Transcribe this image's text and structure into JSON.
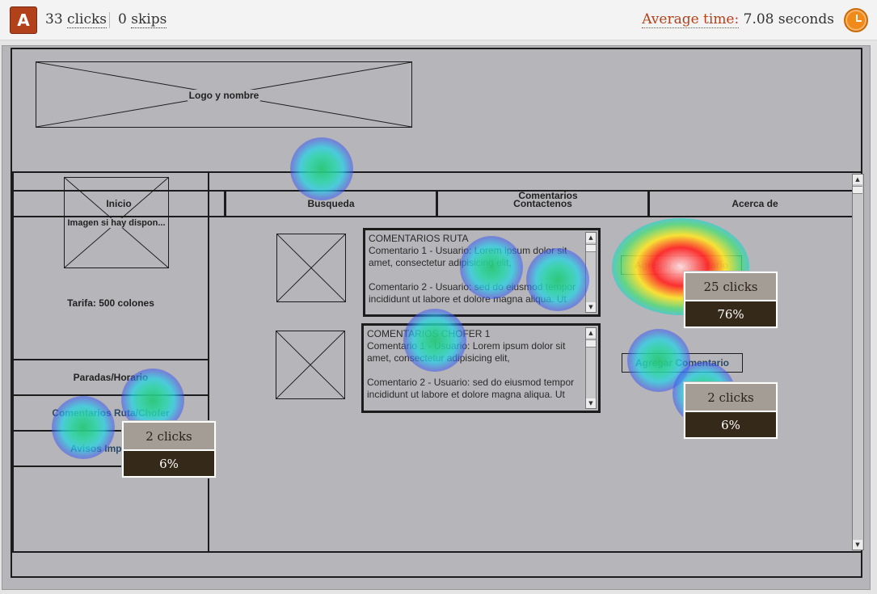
{
  "header": {
    "badge": "A",
    "clicks_count": "33",
    "clicks_label": "clicks",
    "skips_count": "0",
    "skips_label": "skips",
    "avg_label": "Average time:",
    "avg_value": "7.08 seconds"
  },
  "wireframe": {
    "logo": "Logo y nombre",
    "nav": [
      "Inicio",
      "Busqueda",
      "Contactenos",
      "Acerca de"
    ],
    "image_placeholder": "Imagen si hay dispon...",
    "tarifa": "Tarifa:  500 colones",
    "side_menu": [
      "Paradas/Horario",
      "Comentarios Ruta/Chofer",
      "Avisos Impo"
    ],
    "section_title": "Comentarios",
    "comments_ruta": {
      "title": "COMENTARIOS RUTA",
      "lines": [
        "Comentario 1 - Usuario: Lorem ipsum dolor sit",
        "amet, consectetur adipisicing elit,",
        "",
        "Comentario 2 - Usuario: sed do eiusmod tempor",
        "incididunt ut labore et dolore magna aliqua. Ut"
      ]
    },
    "comments_chofer": {
      "title": "COMENTARIOS CHOFER 1",
      "lines": [
        "Comentario 1 - Usuario: Lorem ipsum dolor sit",
        "amet, consectetur adipisicing elit,",
        "",
        "Comentario 2 - Usuario: sed do eiusmod tempor",
        "incididunt ut labore et dolore magna aliqua. Ut"
      ]
    },
    "add_comment_1": "Agregar Comentario",
    "add_comment_2": "Agregar Comentario"
  },
  "tooltips": [
    {
      "clicks": "25 clicks",
      "percent": "76%"
    },
    {
      "clicks": "2 clicks",
      "percent": "6%"
    },
    {
      "clicks": "2 clicks",
      "percent": "6%"
    }
  ],
  "colors": {
    "badge": "#b2401b",
    "wireframe_bg": "#b6b5b9",
    "tooltip_top": "#a39d95",
    "tooltip_bottom": "#35291a"
  }
}
